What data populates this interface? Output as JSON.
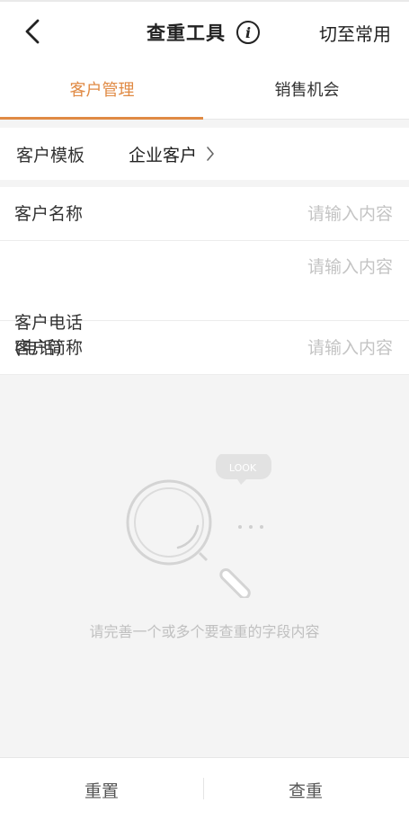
{
  "header": {
    "title": "查重工具",
    "info_icon": "info-icon",
    "back_icon": "chevron-left-icon",
    "switch_label": "切至常用"
  },
  "tabs": [
    {
      "label": "客户管理",
      "active": true
    },
    {
      "label": "销售机会",
      "active": false
    }
  ],
  "template": {
    "label": "客户模板",
    "value": "企业客户",
    "chevron_icon": "chevron-right-icon"
  },
  "fields": [
    {
      "label": "客户名称",
      "value": "",
      "placeholder": "请输入内容"
    },
    {
      "label": "客户电话",
      "label_sub": "(电话)",
      "value": "",
      "placeholder": "请输入内容"
    },
    {
      "label": "客户简称",
      "value": "",
      "placeholder": "请输入内容"
    }
  ],
  "empty_state": {
    "illustration": "magnifier-look-icon",
    "bubble_text": "LOOK",
    "message": "请完善一个或多个要查重的字段内容"
  },
  "footer": {
    "reset_label": "重置",
    "check_label": "查重"
  },
  "colors": {
    "accent": "#e08a44",
    "placeholder": "#c4c4c4",
    "background": "#f4f4f4"
  }
}
